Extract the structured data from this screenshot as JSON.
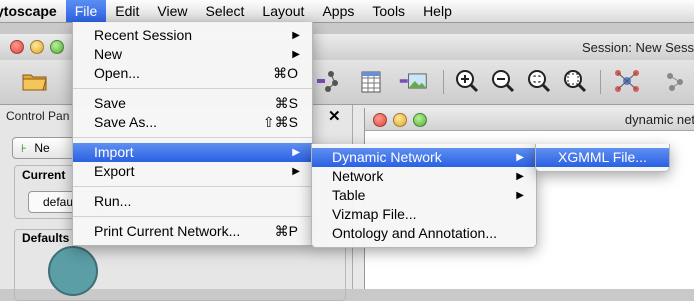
{
  "menubar": {
    "app": "ytoscape",
    "items": [
      "File",
      "Edit",
      "View",
      "Select",
      "Layout",
      "Apps",
      "Tools",
      "Help"
    ]
  },
  "window": {
    "title": "Session: New Sess",
    "control_panel_title": "Control Pan",
    "control_close": "✕",
    "network_tab": "Ne",
    "current_label": "Current",
    "current_combo": "defau",
    "defaults_label": "Defaults"
  },
  "dynamic_frame": {
    "title": "dynamic net"
  },
  "file_menu": {
    "groups": [
      [
        {
          "label": "Recent Session",
          "submenu": true
        },
        {
          "label": "New",
          "submenu": true
        },
        {
          "label": "Open...",
          "shortcut": "⌘O"
        }
      ],
      [
        {
          "label": "Save",
          "shortcut": "⌘S"
        },
        {
          "label": "Save As...",
          "shortcut": "⇧⌘S"
        }
      ],
      [
        {
          "label": "Import",
          "submenu": true,
          "highlighted": true
        },
        {
          "label": "Export",
          "submenu": true
        }
      ],
      [
        {
          "label": "Run..."
        }
      ],
      [
        {
          "label": "Print Current Network...",
          "shortcut": "⌘P"
        }
      ]
    ]
  },
  "import_menu": {
    "items": [
      {
        "label": "Dynamic Network",
        "submenu": true,
        "highlighted": true
      },
      {
        "label": "Network",
        "submenu": true
      },
      {
        "label": "Table",
        "submenu": true
      },
      {
        "label": "Vizmap File..."
      },
      {
        "label": "Ontology and Annotation..."
      }
    ]
  },
  "dynamic_menu": {
    "items": [
      {
        "label": "XGMML File...",
        "highlighted": true
      }
    ]
  },
  "colors": {
    "highlight": "#2d63e6",
    "node_fill": "#5b9ea6"
  }
}
